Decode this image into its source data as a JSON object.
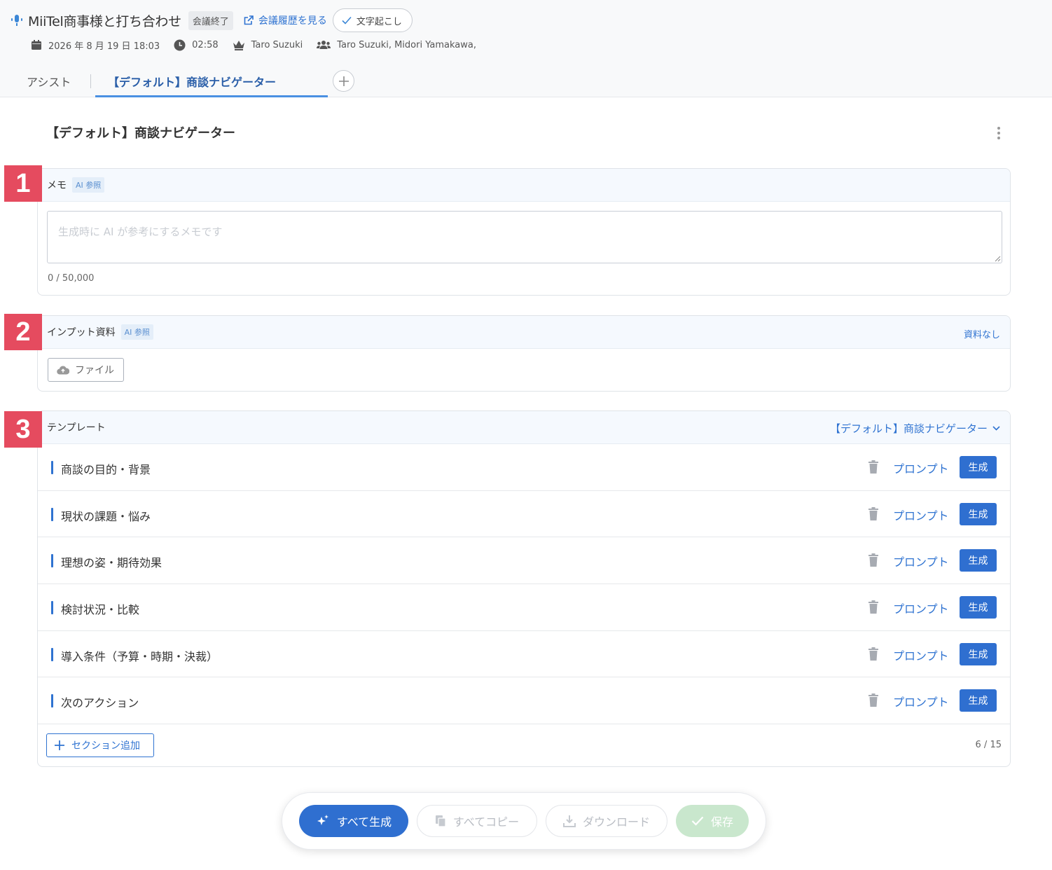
{
  "header": {
    "title": "MiiTel商事様と打ち合わせ",
    "status_badge": "会議終了",
    "history_link": "会議履歴を見る",
    "transcript_button": "文字起こし"
  },
  "meta": {
    "datetime": "2026 年 8 月 19 日 18:03",
    "duration": "02:58",
    "host": "Taro Suzuki",
    "participants": "Taro Suzuki, Midori Yamakawa,"
  },
  "tabs": {
    "assist": "アシスト",
    "active": "【デフォルト】商談ナビゲーター"
  },
  "page": {
    "heading": "【デフォルト】商談ナビゲーター"
  },
  "memo": {
    "badge": "1",
    "label": "メモ",
    "ai_tag": "AI 参照",
    "placeholder": "生成時に AI が参考にするメモです",
    "value": "",
    "count": "0 / 50,000"
  },
  "input_material": {
    "badge": "2",
    "label": "インプット資料",
    "ai_tag": "AI 参照",
    "status": "資料なし",
    "file_button": "ファイル"
  },
  "template": {
    "badge": "3",
    "label": "テンプレート",
    "selected": "【デフォルト】商談ナビゲーター",
    "prompt_label": "プロンプト",
    "generate_label": "生成",
    "sections": [
      "商談の目的・背景",
      "現状の課題・悩み",
      "理想の姿・期待効果",
      "検討状況・比較",
      "導入条件（予算・時期・決裁）",
      "次のアクション"
    ],
    "add_section": "セクション追加",
    "count": "6 / 15"
  },
  "actions": {
    "generate_all": "すべて生成",
    "copy_all": "すべてコピー",
    "download": "ダウンロード",
    "save": "保存"
  },
  "colors": {
    "accent": "#2f6fd0",
    "badge_red": "#e54b5f",
    "save_disabled": "#c9e7cd"
  }
}
